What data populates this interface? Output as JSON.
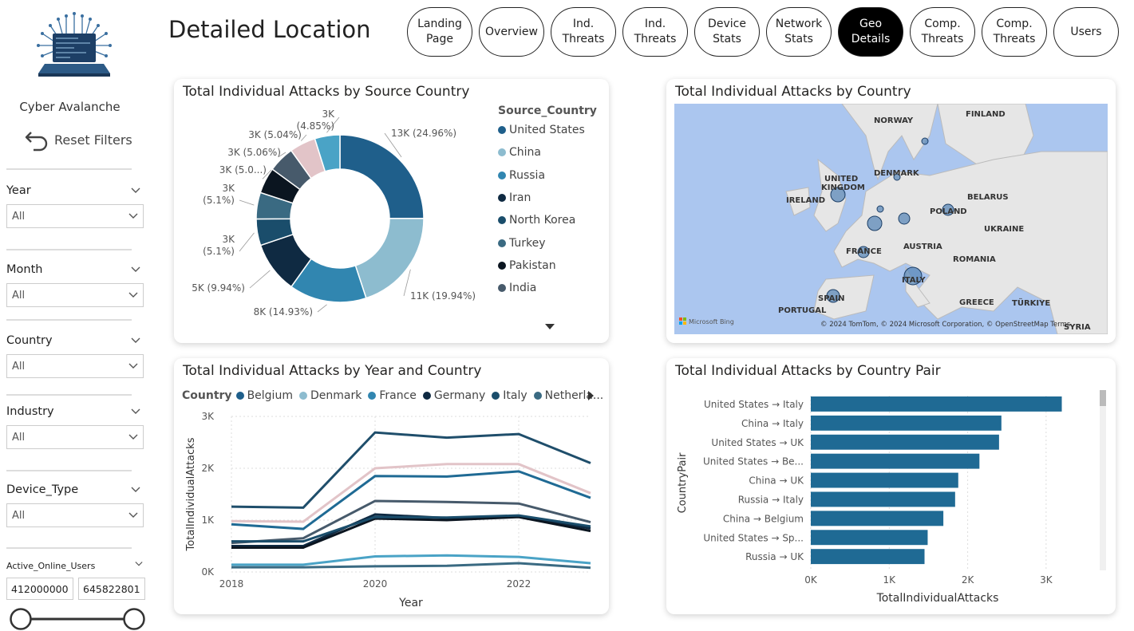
{
  "app": {
    "name": "Cyber Avalanche",
    "reset_label": "Reset Filters",
    "page_title": "Detailed Location"
  },
  "nav": [
    {
      "label": "Landing Page",
      "active": false
    },
    {
      "label": "Overview",
      "active": false
    },
    {
      "label": "Ind. Threats",
      "active": false
    },
    {
      "label": "Ind. Threats",
      "active": false
    },
    {
      "label": "Device Stats",
      "active": false
    },
    {
      "label": "Network Stats",
      "active": false
    },
    {
      "label": "Geo Details",
      "active": true
    },
    {
      "label": "Comp. Threats",
      "active": false
    },
    {
      "label": "Comp. Threats",
      "active": false
    },
    {
      "label": "Users",
      "active": false
    }
  ],
  "filters": [
    {
      "label": "Year",
      "value": "All"
    },
    {
      "label": "Month",
      "value": "All"
    },
    {
      "label": "Country",
      "value": "All"
    },
    {
      "label": "Industry",
      "value": "All"
    },
    {
      "label": "Device_Type",
      "value": "All"
    }
  ],
  "range_filter": {
    "label": "Active_Online_Users",
    "min": "412000000",
    "max": "645822801"
  },
  "donut": {
    "title": "Total Individual Attacks by Source Country",
    "legend_title": "Source_Country",
    "colors": [
      "#1f5f8b",
      "#8dbccf",
      "#3186b0",
      "#0f2a42",
      "#1a4d6b",
      "#3a6a82",
      "#0b1520",
      "#475a6b",
      "#e2c4c8",
      "#4aa3c6"
    ],
    "chart_data": {
      "type": "pie",
      "categories": [
        "United States",
        "China",
        "Russia",
        "Iran",
        "North Korea",
        "Turkey",
        "Pakistan",
        "India",
        "",
        ""
      ],
      "values": [
        24.96,
        19.94,
        14.93,
        9.94,
        5.1,
        5.1,
        5.0,
        5.06,
        5.04,
        4.85
      ],
      "labels": [
        "13K (24.96%)",
        "11K (19.94%)",
        "8K (14.93%)",
        "5K (9.94%)",
        "3K (5.1%)",
        "3K (5.1%)",
        "3K (5.0...)",
        "3K (5.06%)",
        "3K (5.04%)",
        "3K (4.85%)"
      ]
    },
    "legend": [
      "United States",
      "China",
      "Russia",
      "Iran",
      "North Korea",
      "Turkey",
      "Pakistan",
      "India"
    ]
  },
  "map": {
    "title": "Total Individual Attacks by Country",
    "countries": [
      "NORWAY",
      "FINLAND",
      "DENMARK",
      "UNITED KINGDOM",
      "IRELAND",
      "BELARUS",
      "POLAND",
      "UKRAINE",
      "FRANCE",
      "AUSTRIA",
      "ROMANIA",
      "ITALY",
      "SPAIN",
      "PORTUGAL",
      "GREECE",
      "TÜRKIYE",
      "SYRIA"
    ],
    "copyright": "© 2024 TomTom, © 2024 Microsoft Corporation, © OpenStreetMap  Terms",
    "brand": "Microsoft Bing"
  },
  "line": {
    "title": "Total Individual Attacks by Year and Country",
    "legend_title": "Country",
    "legend": [
      {
        "name": "Belgium",
        "color": "#1f5f8b"
      },
      {
        "name": "Denmark",
        "color": "#8dbccf"
      },
      {
        "name": "France",
        "color": "#3186b0"
      },
      {
        "name": "Germany",
        "color": "#0f2a42"
      },
      {
        "name": "Italy",
        "color": "#1a4d6b"
      },
      {
        "name": "Netherla...",
        "color": "#3a6a82"
      }
    ],
    "chart_data": {
      "type": "line",
      "x": [
        2018,
        2019,
        2020,
        2021,
        2022,
        2023
      ],
      "xticks": [
        "2018",
        "2020",
        "2022"
      ],
      "ylim": [
        0,
        3000
      ],
      "yticks": [
        "0K",
        "1K",
        "2K",
        "3K"
      ],
      "xlabel": "Year",
      "ylabel": "TotalIndividualAttacks",
      "series": [
        {
          "color": "#1f4e6b",
          "values": [
            1260,
            1240,
            2690,
            2590,
            2660,
            2100
          ]
        },
        {
          "color": "#e2c4c8",
          "values": [
            980,
            970,
            2000,
            2080,
            2080,
            1520
          ]
        },
        {
          "color": "#1f6a94",
          "values": [
            920,
            830,
            1850,
            1840,
            1940,
            1430
          ]
        },
        {
          "color": "#475a6b",
          "values": [
            560,
            650,
            1370,
            1350,
            1320,
            960
          ]
        },
        {
          "color": "#0f2a42",
          "values": [
            500,
            500,
            1110,
            1040,
            1070,
            840
          ]
        },
        {
          "color": "#0b1520",
          "values": [
            470,
            470,
            1030,
            1000,
            1060,
            790
          ]
        },
        {
          "color": "#1a4d6b",
          "values": [
            590,
            590,
            1060,
            1050,
            1090,
            880
          ]
        },
        {
          "color": "#4aa3c6",
          "values": [
            140,
            140,
            300,
            320,
            290,
            170
          ]
        },
        {
          "color": "#3a6a82",
          "values": [
            90,
            90,
            110,
            120,
            170,
            80
          ]
        }
      ]
    }
  },
  "bar": {
    "title": "Total Individual Attacks by Country Pair",
    "chart_data": {
      "type": "bar",
      "categories": [
        "United States → Italy",
        "China → Italy",
        "United States → UK",
        "United States → Be...",
        "China → UK",
        "Russia → Italy",
        "China → Belgium",
        "United States → Sp...",
        "Russia → UK"
      ],
      "values": [
        3200,
        2430,
        2400,
        2150,
        1880,
        1840,
        1690,
        1490,
        1450
      ],
      "xlim": [
        0,
        3500
      ],
      "xticks": [
        "0K",
        "1K",
        "2K",
        "3K"
      ],
      "xlabel": "TotalIndividualAttacks",
      "ylabel": "CountryPair",
      "color": "#1f6a94"
    }
  }
}
